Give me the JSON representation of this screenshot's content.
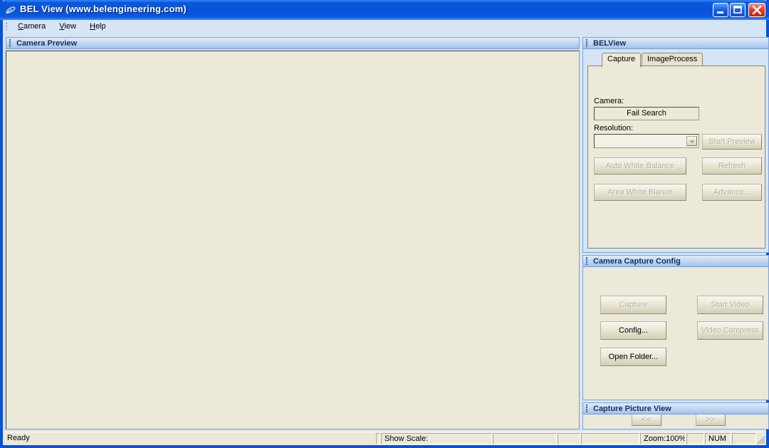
{
  "window": {
    "title": "BEL View (www.belengineering.com)",
    "icon": "app-icon",
    "buttons": {
      "minimize": "minimize-icon",
      "maximize": "maximize-icon",
      "close": "close-icon"
    }
  },
  "menubar": {
    "items": [
      {
        "label": "Camera",
        "accel": "C"
      },
      {
        "label": "View",
        "accel": "V"
      },
      {
        "label": "Help",
        "accel": "H"
      }
    ]
  },
  "preview_panel": {
    "title": "Camera Preview",
    "content": ""
  },
  "belview_panel": {
    "title": "BELView",
    "tabs": [
      {
        "label": "Capture",
        "active": true
      },
      {
        "label": "ImageProcess",
        "active": false
      }
    ],
    "camera_label": "Camera:",
    "camera_value": "Fail Search",
    "resolution_label": "Resolution:",
    "resolution_value": "",
    "buttons": [
      {
        "label": "Start Preview",
        "enabled": false
      },
      {
        "label": "Auto White Balance",
        "enabled": false
      },
      {
        "label": "Refresh",
        "enabled": false
      },
      {
        "label": "Area White Blance",
        "enabled": false
      },
      {
        "label": "Advance...",
        "enabled": false
      }
    ]
  },
  "capture_config_panel": {
    "title": "Camera Capture Config",
    "buttons": [
      {
        "label": "Capture",
        "enabled": false
      },
      {
        "label": "Start Video",
        "enabled": false
      },
      {
        "label": "Config...",
        "enabled": true
      },
      {
        "label": "Video Compress",
        "enabled": false
      },
      {
        "label": "Open Folder...",
        "enabled": true
      }
    ]
  },
  "capture_picture_view_panel": {
    "title": "Capture Picture View",
    "nav_prev": "<<",
    "nav_next": ">>"
  },
  "statusbar": {
    "ready": "Ready",
    "show_scale": "Show Scale:",
    "cell_a": "",
    "cell_b": "",
    "zoom": "Zoom:100%",
    "cell_c": "",
    "num": "NUM",
    "cell_d": ""
  },
  "colors": {
    "titlebar_blue": "#0854db",
    "panel_header_blue": "#a8c6ee",
    "face": "#ece9d8",
    "dialog_bg": "#d6e5f5",
    "close_red": "#e2402a"
  }
}
